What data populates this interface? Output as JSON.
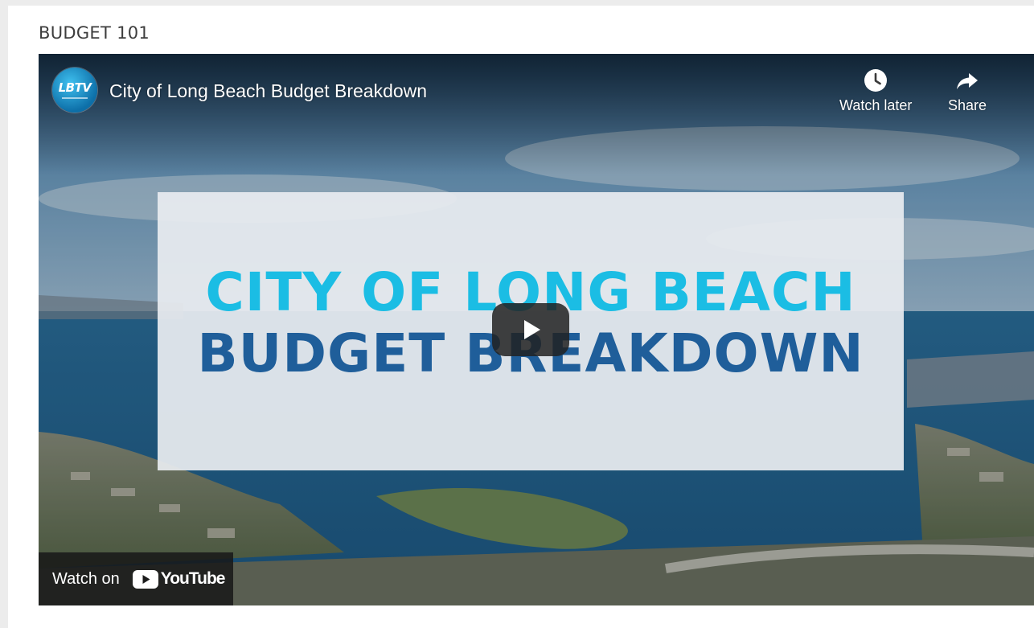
{
  "section": {
    "heading": "BUDGET 101"
  },
  "video": {
    "title": "City of Long Beach Budget Breakdown",
    "channel_logo_text": "LBTV",
    "thumbnail_line_1": "CITY OF LONG BEACH",
    "thumbnail_line_2": "BUDGET BREAKDOWN",
    "actions": {
      "watch_later_label": "Watch later",
      "share_label": "Share"
    },
    "watch_on_label": "Watch on",
    "youtube_wordmark": "YouTube",
    "icons": {
      "watch_later": "clock-icon",
      "share": "share-arrow-icon",
      "play": "play-icon",
      "youtube": "youtube-logo-icon"
    }
  },
  "colors": {
    "thumbnail_cyan": "#1bbde4",
    "thumbnail_blue": "#1f5e9a",
    "heading_text": "#3d3d3d"
  }
}
